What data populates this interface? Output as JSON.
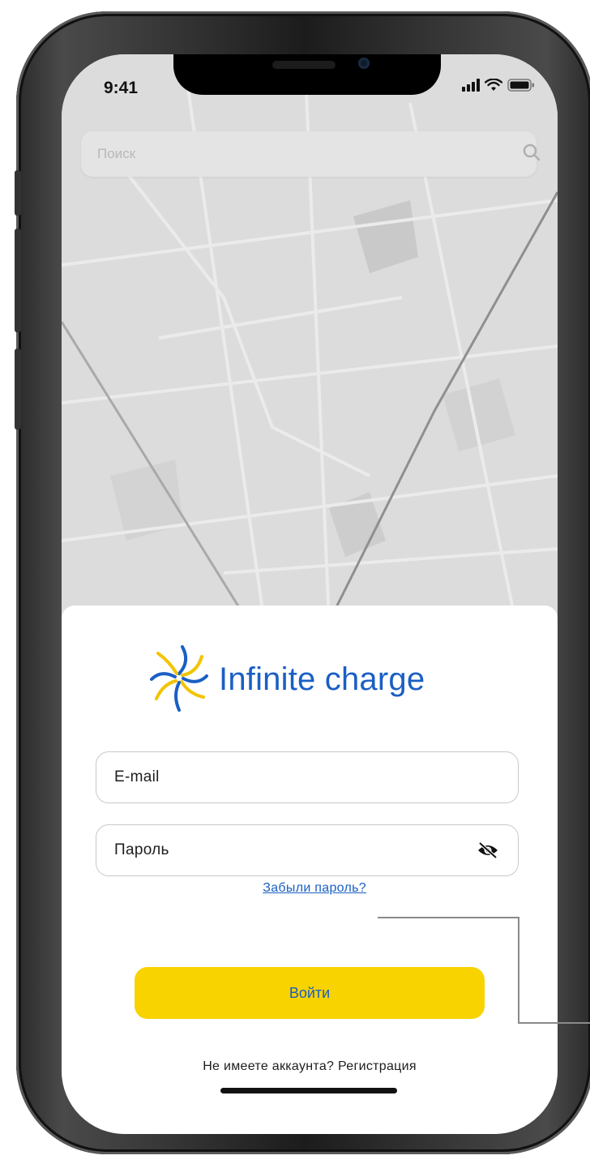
{
  "status_bar": {
    "time": "9:41"
  },
  "search": {
    "placeholder": "Поиск"
  },
  "brand": {
    "name": "Infinite charge"
  },
  "form": {
    "email_label": "E-mail",
    "password_label": "Пароль",
    "forgot_link": "Забыли пароль?",
    "login_button": "Войти",
    "register_text": "Не имеете аккаунта? Регистрация"
  },
  "colors": {
    "accent": "#1a5fc4",
    "button": "#f8d300",
    "logo_blue": "#1a5fc4",
    "logo_yellow": "#f2c400"
  },
  "icons": {
    "search": "search-icon",
    "password_toggle": "eye-slash-icon",
    "signal": "signal-icon",
    "wifi": "wifi-icon",
    "battery": "battery-icon"
  }
}
